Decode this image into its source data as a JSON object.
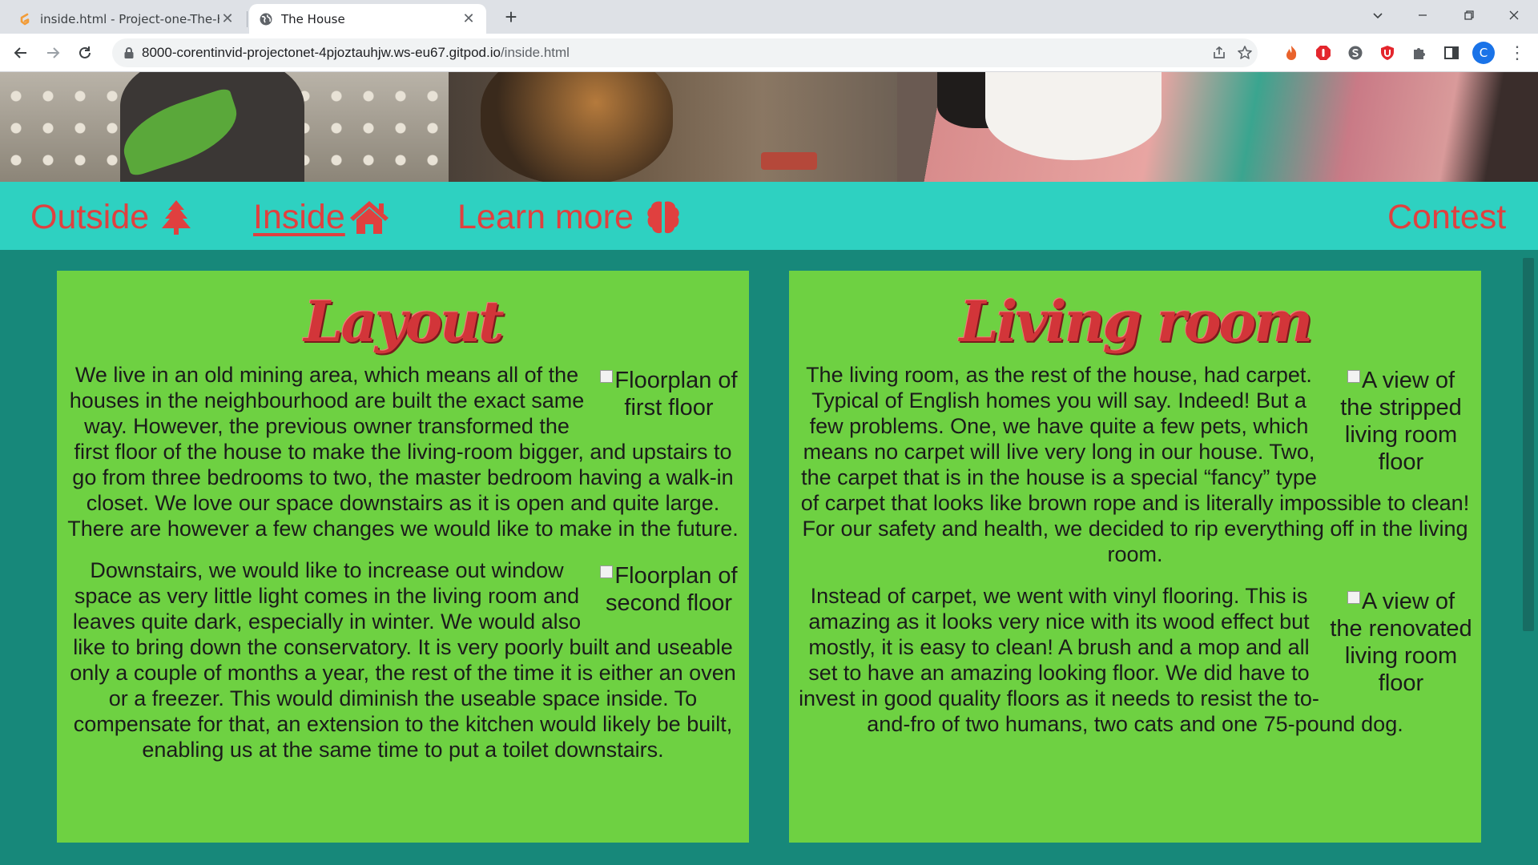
{
  "browser": {
    "tabs": [
      {
        "title": "inside.html - Project-one-The-Ho",
        "active": false,
        "favicon": "gitpod-icon"
      },
      {
        "title": "The House",
        "active": true,
        "favicon": "globe-icon"
      }
    ],
    "new_tab_label": "+",
    "url_host": "8000-corentinvid-projectonet-4pjoztauhjw.ws-eu67.gitpod.io",
    "url_path": "/inside.html",
    "profile_initial": "C",
    "accent": "#1a73e8"
  },
  "nav": {
    "items": [
      {
        "label": "Outside",
        "icon": "tree-icon",
        "current": false
      },
      {
        "label": "Inside",
        "icon": "house-icon",
        "current": true
      },
      {
        "label": "Learn more",
        "icon": "brain-icon",
        "current": false
      },
      {
        "label": "Contest",
        "icon": "",
        "current": false
      }
    ],
    "color": "#e0403f",
    "background": "#2ed1c1"
  },
  "cards": [
    {
      "title": "Layout",
      "sections": [
        {
          "img_alt": "Floorplan of first floor",
          "text": "We live in an old mining area, which means all of the houses in the neighbourhood are built the exact same way. However, the previous owner transformed the first floor of the house to make the living-room bigger, and upstairs to go from three bedrooms to two, the master bedroom having a walk-in closet. We love our space downstairs as it is open and quite large. There are however a few changes we would like to make in the future."
        },
        {
          "img_alt": "Floorplan of second floor",
          "text": "Downstairs, we would like to increase out window space as very little light comes in the living room and leaves quite dark, especially in winter. We would also like to bring down the conservatory. It is very poorly built and useable only a couple of months a year, the rest of the time it is either an oven or a freezer. This would diminish the useable space inside. To compensate for that, an extension to the kitchen would likely be built, enabling us at the same time to put a toilet downstairs."
        }
      ]
    },
    {
      "title": "Living room",
      "sections": [
        {
          "img_alt": "A view of the stripped living room floor",
          "text": "The living room, as the rest of the house, had carpet. Typical of English homes you will say. Indeed! But a few problems. One, we have quite a few pets, which means no carpet will live very long in our house. Two, the carpet that is in the house is a special “fancy” type of carpet that looks like brown rope and is literally impossible to clean! For our safety and health, we decided to rip everything off in the living room."
        },
        {
          "img_alt": "A view of the renovated living room floor",
          "text": "Instead of carpet, we went with vinyl flooring. This is amazing as it looks very nice with its wood effect but mostly, it is easy to clean! A brush and a mop and all set to have an amazing looking floor. We did have to invest in good quality floors as it needs to resist the to-and-fro of two humans, two cats and one 75-pound dog."
        }
      ]
    }
  ],
  "colors": {
    "page_background": "#17887a",
    "card_background": "#6ed142",
    "title_color": "#d23539"
  }
}
